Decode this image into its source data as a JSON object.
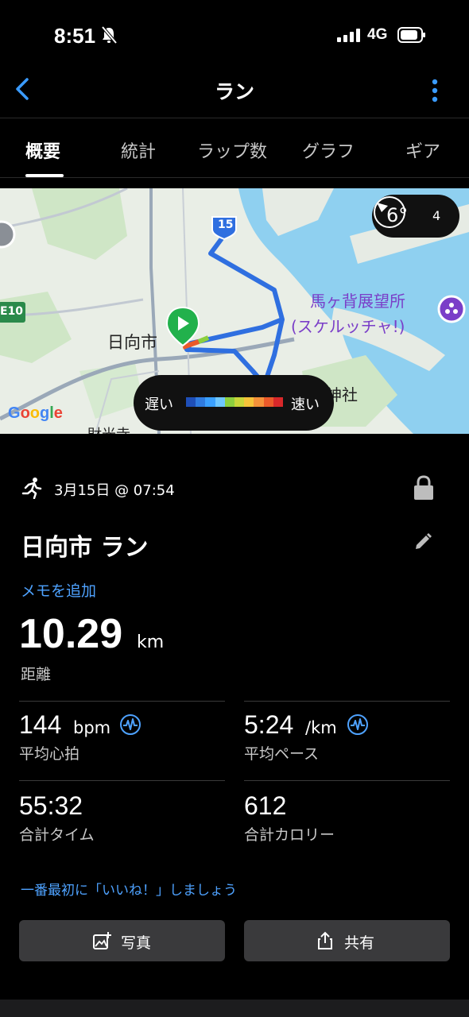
{
  "status_bar": {
    "time": "8:51",
    "network": "4G"
  },
  "nav": {
    "title": "ラン"
  },
  "tabs": [
    {
      "label": "概要"
    },
    {
      "label": "統計"
    },
    {
      "label": "ラップ数"
    },
    {
      "label": "グラフ"
    },
    {
      "label": "ギア"
    }
  ],
  "map": {
    "weather_temp": "6°",
    "weather_wind": "4",
    "route_badge": "15",
    "road_label": "E10",
    "city_label": "日向市",
    "poi_label": "馬ヶ背展望所",
    "poi_sub": "(スケルッチャ!)",
    "shrine_label": "神社",
    "bottom_label": "財光寺",
    "speed_slow": "遅い",
    "speed_fast": "速い",
    "speed_colors": [
      "#1f4fb8",
      "#2f7be0",
      "#3aa0ff",
      "#6fc7ff",
      "#8ccf3e",
      "#c8d63a",
      "#f5c33a",
      "#f4923a",
      "#ea5a2a",
      "#d8282a"
    ],
    "attribution": "Google"
  },
  "activity": {
    "date": "3月15日 @ 07:54",
    "title": "日向市 ラン",
    "memo_link": "メモを追加",
    "distance": "10.29",
    "distance_unit": "km",
    "distance_label": "距離"
  },
  "stats": {
    "heart_rate": {
      "value": "144",
      "unit": "bpm",
      "label": "平均心拍"
    },
    "pace": {
      "value": "5:24",
      "unit": "/km",
      "label": "平均ペース"
    },
    "time": {
      "value": "55:32",
      "label": "合計タイム"
    },
    "calories": {
      "value": "612",
      "label": "合計カロリー"
    }
  },
  "like_prompt": "一番最初に「いいね！」しましょう",
  "buttons": {
    "photo": "写真",
    "share": "共有"
  },
  "colors": {
    "accent": "#4ea2ff",
    "route": "#2f6fe0",
    "start_marker": "#22b14c"
  }
}
